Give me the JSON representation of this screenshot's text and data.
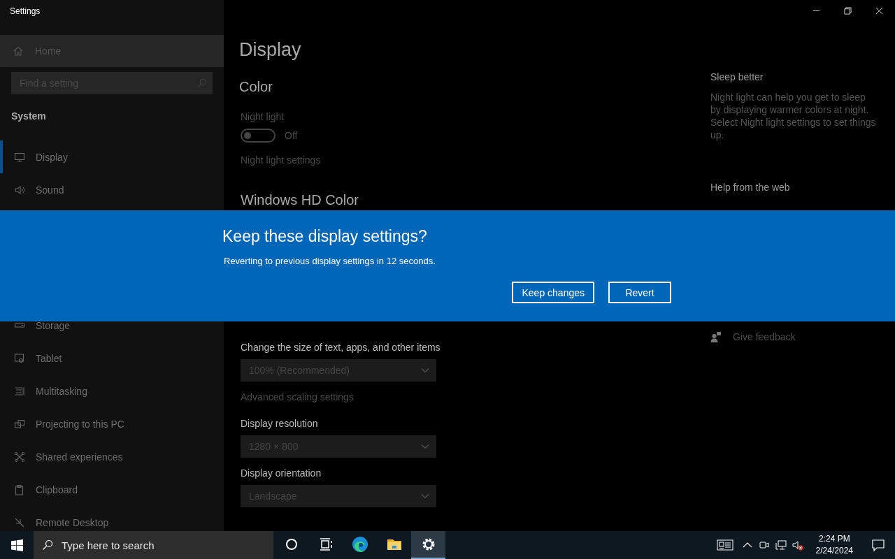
{
  "window": {
    "title": "Settings"
  },
  "sidebar": {
    "home": "Home",
    "search": {
      "placeholder": "Find a setting"
    },
    "section": "System",
    "items_top": [
      {
        "label": "Display",
        "kind": "display",
        "selected": true
      },
      {
        "label": "Sound",
        "kind": "sound",
        "selected": false
      }
    ],
    "items_bottom": [
      {
        "label": "Storage",
        "kind": "storage",
        "selected": false
      },
      {
        "label": "Tablet",
        "kind": "tablet",
        "selected": false
      },
      {
        "label": "Multitasking",
        "kind": "multitasking",
        "selected": false
      },
      {
        "label": "Projecting to this PC",
        "kind": "projecting",
        "selected": false
      },
      {
        "label": "Shared experiences",
        "kind": "shared",
        "selected": false
      },
      {
        "label": "Clipboard",
        "kind": "clipboard",
        "selected": false
      },
      {
        "label": "Remote Desktop",
        "kind": "remote",
        "selected": false
      }
    ]
  },
  "main": {
    "title": "Display",
    "color_heading": "Color",
    "night_light": {
      "label": "Night light",
      "on": false,
      "state_text": "Off"
    },
    "night_light_link": "Night light settings",
    "hd_heading": "Windows HD Color",
    "settings": [
      {
        "label": "Change the size of text, apps, and other items",
        "value": "100% (Recommended)",
        "link": "Advanced scaling settings"
      },
      {
        "label": "Display resolution",
        "value": "1280 × 800"
      },
      {
        "label": "Display orientation",
        "value": "Landscape"
      }
    ]
  },
  "aside": {
    "sleep_title": "Sleep better",
    "sleep_text": "Night light can help you get to sleep by displaying warmer colors at night. Select Night light settings to set things up.",
    "help_title": "Help from the web",
    "feedback": "Give feedback"
  },
  "dialog": {
    "title": "Keep these display settings?",
    "message": "Reverting to previous display settings in 12 seconds.",
    "buttons": [
      "Keep changes",
      "Revert"
    ]
  },
  "taskbar": {
    "search": {
      "placeholder": "Type here to search"
    },
    "apps": [
      {
        "kind": "cortana",
        "selected": false
      },
      {
        "kind": "taskview",
        "selected": false
      },
      {
        "kind": "edge",
        "selected": false
      },
      {
        "kind": "explorer",
        "selected": false
      },
      {
        "kind": "settings",
        "selected": true
      }
    ],
    "volume_muted": true,
    "time": "2:24 PM",
    "date": "2/24/2024"
  }
}
